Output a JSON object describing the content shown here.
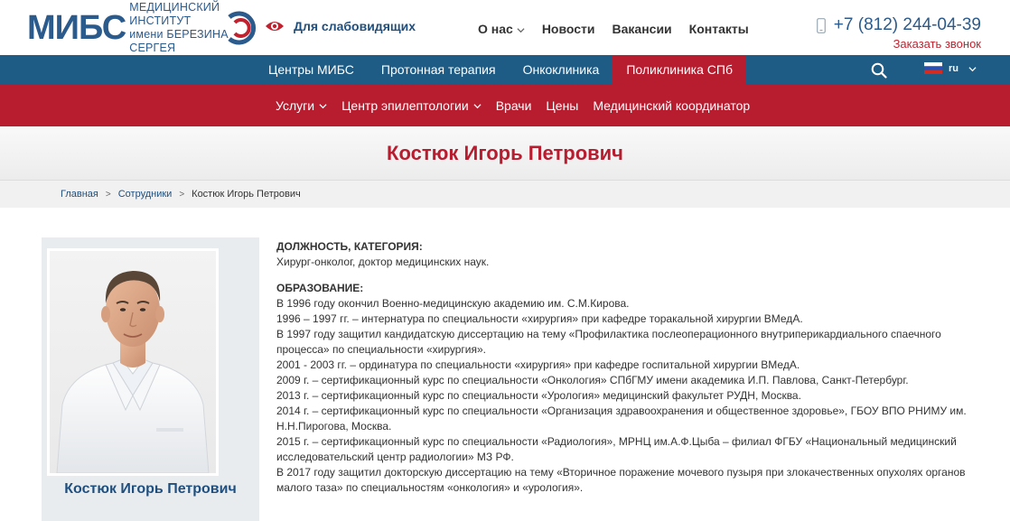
{
  "header": {
    "logo": {
      "mark": "МИБС",
      "line1": "МЕДИЦИНСКИЙ ИНСТИТУТ",
      "line2": "имени БЕРЕЗИНА СЕРГЕЯ"
    },
    "low_vision_label": "Для слабовидящих",
    "top_nav": [
      {
        "label": "О нас",
        "has_dropdown": true
      },
      {
        "label": "Новости",
        "has_dropdown": false
      },
      {
        "label": "Вакансии",
        "has_dropdown": false
      },
      {
        "label": "Контакты",
        "has_dropdown": false
      }
    ],
    "phone": "+7 (812) 244-04-39",
    "callback_label": "Заказать звонок"
  },
  "main_nav": {
    "items": [
      {
        "label": "Центры МИБС",
        "active": false
      },
      {
        "label": "Протонная терапия",
        "active": false
      },
      {
        "label": "Онкоклиника",
        "active": false
      },
      {
        "label": "Поликлиника СПб",
        "active": true
      }
    ],
    "lang": "ru"
  },
  "sub_nav": {
    "items": [
      {
        "label": "Услуги",
        "has_dropdown": true
      },
      {
        "label": "Центр эпилептологии",
        "has_dropdown": true
      },
      {
        "label": "Врачи",
        "has_dropdown": false
      },
      {
        "label": "Цены",
        "has_dropdown": false
      },
      {
        "label": "Медицинский координатор",
        "has_dropdown": false
      }
    ]
  },
  "page": {
    "title": "Костюк Игорь Петрович"
  },
  "breadcrumb": {
    "home": "Главная",
    "staff": "Сотрудники",
    "current": "Костюк Игорь Петрович",
    "separator": ">"
  },
  "profile": {
    "name": "Костюк Игорь Петрович"
  },
  "bio": {
    "position_heading": "ДОЛЖНОСТЬ, КАТЕГОРИЯ:",
    "position_text": "Хирург-онколог, доктор медицинских наук.",
    "education_heading": "ОБРАЗОВАНИЕ:",
    "education_lines": [
      "В 1996 году окончил Военно-медицинскую академию им. С.М.Кирова.",
      "1996 – 1997 гг. – интернатура по специальности «хирургия» при кафедре торакальной хирургии ВМедА.",
      "В 1997 году защитил кандидатскую диссертацию на тему «Профилактика послеоперационного внутриперикардиального спаечного",
      "процесса» по специальности «хирургия».",
      "2001 - 2003 гг. – ординатура по специальности «хирургия» при кафедре госпитальной хирургии ВМедА.",
      "2009 г. – сертификационный курс по специальности «Онкология» СПбГМУ имени академика И.П. Павлова, Санкт-Петербург.",
      "2013 г. – сертификационный курс по специальности «Урология» медицинский факультет РУДН, Москва.",
      "2014 г. – сертификационный курс по специальности «Организация здравоохранения и общественное здоровье», ГБОУ ВПО РНИМУ им.",
      "Н.Н.Пирогова, Москва.",
      "2015 г. – сертификационный курс по специальности «Радиология», МРНЦ им.А.Ф.Цыба – филиал ФГБУ «Национальный медицинский",
      "исследовательский центр радиологии» МЗ РФ.",
      "В 2017 году защитил докторскую диссертацию на тему «Вторичное поражение мочевого пузыря при злокачественных опухолях органов",
      "малого таза» по специальностям «онкология» и «урология»."
    ]
  },
  "colors": {
    "brand_blue": "#1e5c86",
    "brand_red": "#b81c2f",
    "link_blue": "#1f4f7e"
  }
}
